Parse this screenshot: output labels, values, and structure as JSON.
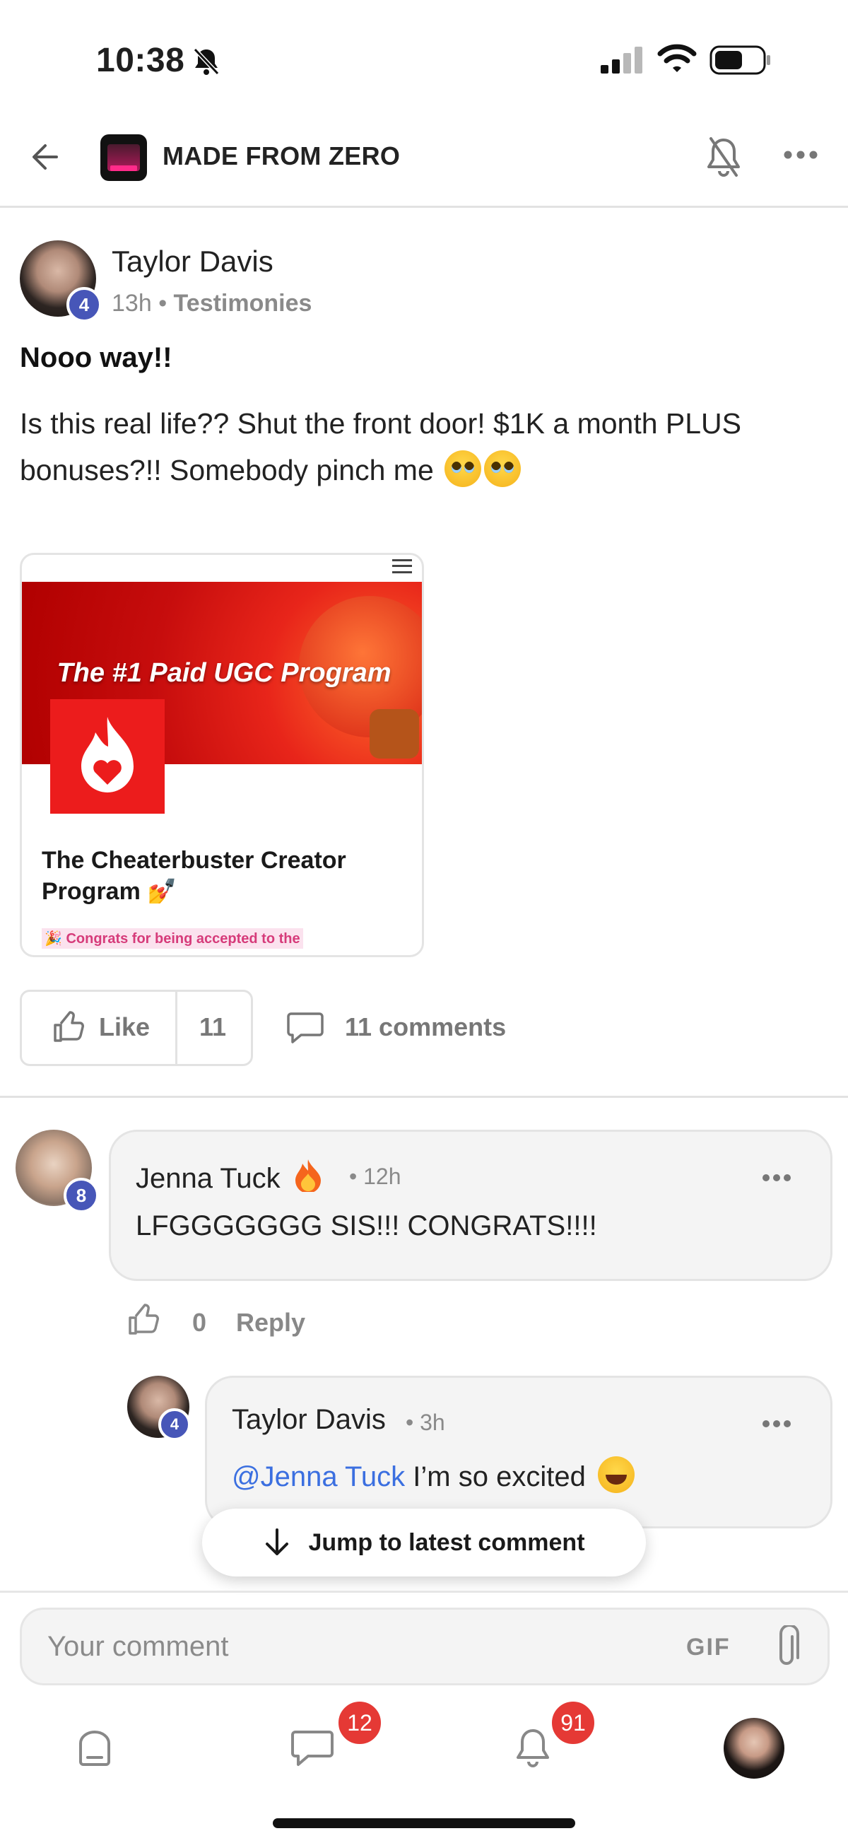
{
  "status_bar": {
    "time": "10:38"
  },
  "header": {
    "group_name": "MADE FROM ZERO"
  },
  "post": {
    "author": "Taylor Davis",
    "level": "4",
    "time": "13h",
    "separator": "•",
    "category": "Testimonies",
    "title": "Nooo way!!",
    "body": "Is this real life?? Shut the front door! $1K a month PLUS bonuses?!! Somebody pinch me",
    "preview": {
      "banner_title": "The #1 Paid UGC Program",
      "card_title": "The Cheaterbuster Creator Program 💅",
      "card_subtitle": "🎉 Congrats for being accepted to the"
    },
    "like_label": "Like",
    "like_count": "11",
    "comments_label": "11 comments"
  },
  "comments": [
    {
      "author": "Jenna Tuck",
      "level": "8",
      "time": "• 12h",
      "text": "LFGGGGGGG SIS!!! CONGRATS!!!!",
      "like_count": "0",
      "reply_label": "Reply"
    },
    {
      "author": "Taylor Davis",
      "level": "4",
      "time": "• 3h",
      "mention": "@Jenna Tuck",
      "text": " I’m so excited"
    }
  ],
  "jump_label": "Jump to latest comment",
  "composer": {
    "placeholder": "Your comment",
    "gif_label": "GIF"
  },
  "nav": {
    "chat_badge": "12",
    "notifications_badge": "91"
  },
  "colors": {
    "level_badge": "#4756b8",
    "mention": "#3b6fe0",
    "notification_badge": "#e53935"
  }
}
